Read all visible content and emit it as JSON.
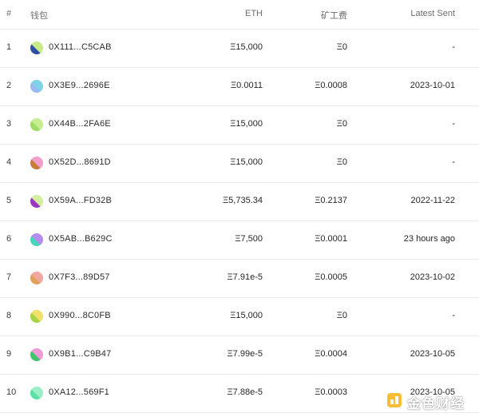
{
  "headers": {
    "index": "#",
    "wallet": "钱包",
    "eth": "ETH",
    "fee": "矿工费",
    "latest_sent": "Latest Sent"
  },
  "rows": [
    {
      "index": "1",
      "wallet": "0X111...C5CAB",
      "eth": "Ξ15,000",
      "fee": "Ξ0",
      "latest_sent": "-",
      "avatar_colors": [
        "#2e4fa3",
        "#c9ea88"
      ]
    },
    {
      "index": "2",
      "wallet": "0X3E9...2696E",
      "eth": "Ξ0.0011",
      "fee": "Ξ0.0008",
      "latest_sent": "2023-10-01",
      "avatar_colors": [
        "#9bb8f0",
        "#7ed3e6"
      ]
    },
    {
      "index": "3",
      "wallet": "0X44B...2FA6E",
      "eth": "Ξ15,000",
      "fee": "Ξ0",
      "latest_sent": "-",
      "avatar_colors": [
        "#9edb6a",
        "#c6ee8e"
      ]
    },
    {
      "index": "4",
      "wallet": "0X52D...8691D",
      "eth": "Ξ15,000",
      "fee": "Ξ0",
      "latest_sent": "-",
      "avatar_colors": [
        "#c77d3a",
        "#f0a0c8"
      ]
    },
    {
      "index": "5",
      "wallet": "0X59A...FD32B",
      "eth": "Ξ5,735.34",
      "fee": "Ξ0.2137",
      "latest_sent": "2022-11-22",
      "avatar_colors": [
        "#9b36c2",
        "#d3ee9e"
      ]
    },
    {
      "index": "6",
      "wallet": "0X5AB...B629C",
      "eth": "Ξ7,500",
      "fee": "Ξ0.0001",
      "latest_sent": "23 hours ago",
      "avatar_colors": [
        "#46d6b8",
        "#b58cf0"
      ]
    },
    {
      "index": "7",
      "wallet": "0X7F3...89D57",
      "eth": "Ξ7.91e-5",
      "fee": "Ξ0.0005",
      "latest_sent": "2023-10-02",
      "avatar_colors": [
        "#e4a05a",
        "#f0a8a0"
      ]
    },
    {
      "index": "8",
      "wallet": "0X990...8C0FB",
      "eth": "Ξ15,000",
      "fee": "Ξ0",
      "latest_sent": "-",
      "avatar_colors": [
        "#a6d44a",
        "#f1e06a"
      ]
    },
    {
      "index": "9",
      "wallet": "0X9B1...C9B47",
      "eth": "Ξ7.99e-5",
      "fee": "Ξ0.0004",
      "latest_sent": "2023-10-05",
      "avatar_colors": [
        "#3fc46a",
        "#ee9ad6"
      ]
    },
    {
      "index": "10",
      "wallet": "0XA12...569F1",
      "eth": "Ξ7.88e-5",
      "fee": "Ξ0.0003",
      "latest_sent": "2023-10-05",
      "avatar_colors": [
        "#5ee0a4",
        "#9af0c6"
      ]
    }
  ],
  "watermark": {
    "text": "金色财经",
    "logo_color": "#f5b820"
  }
}
